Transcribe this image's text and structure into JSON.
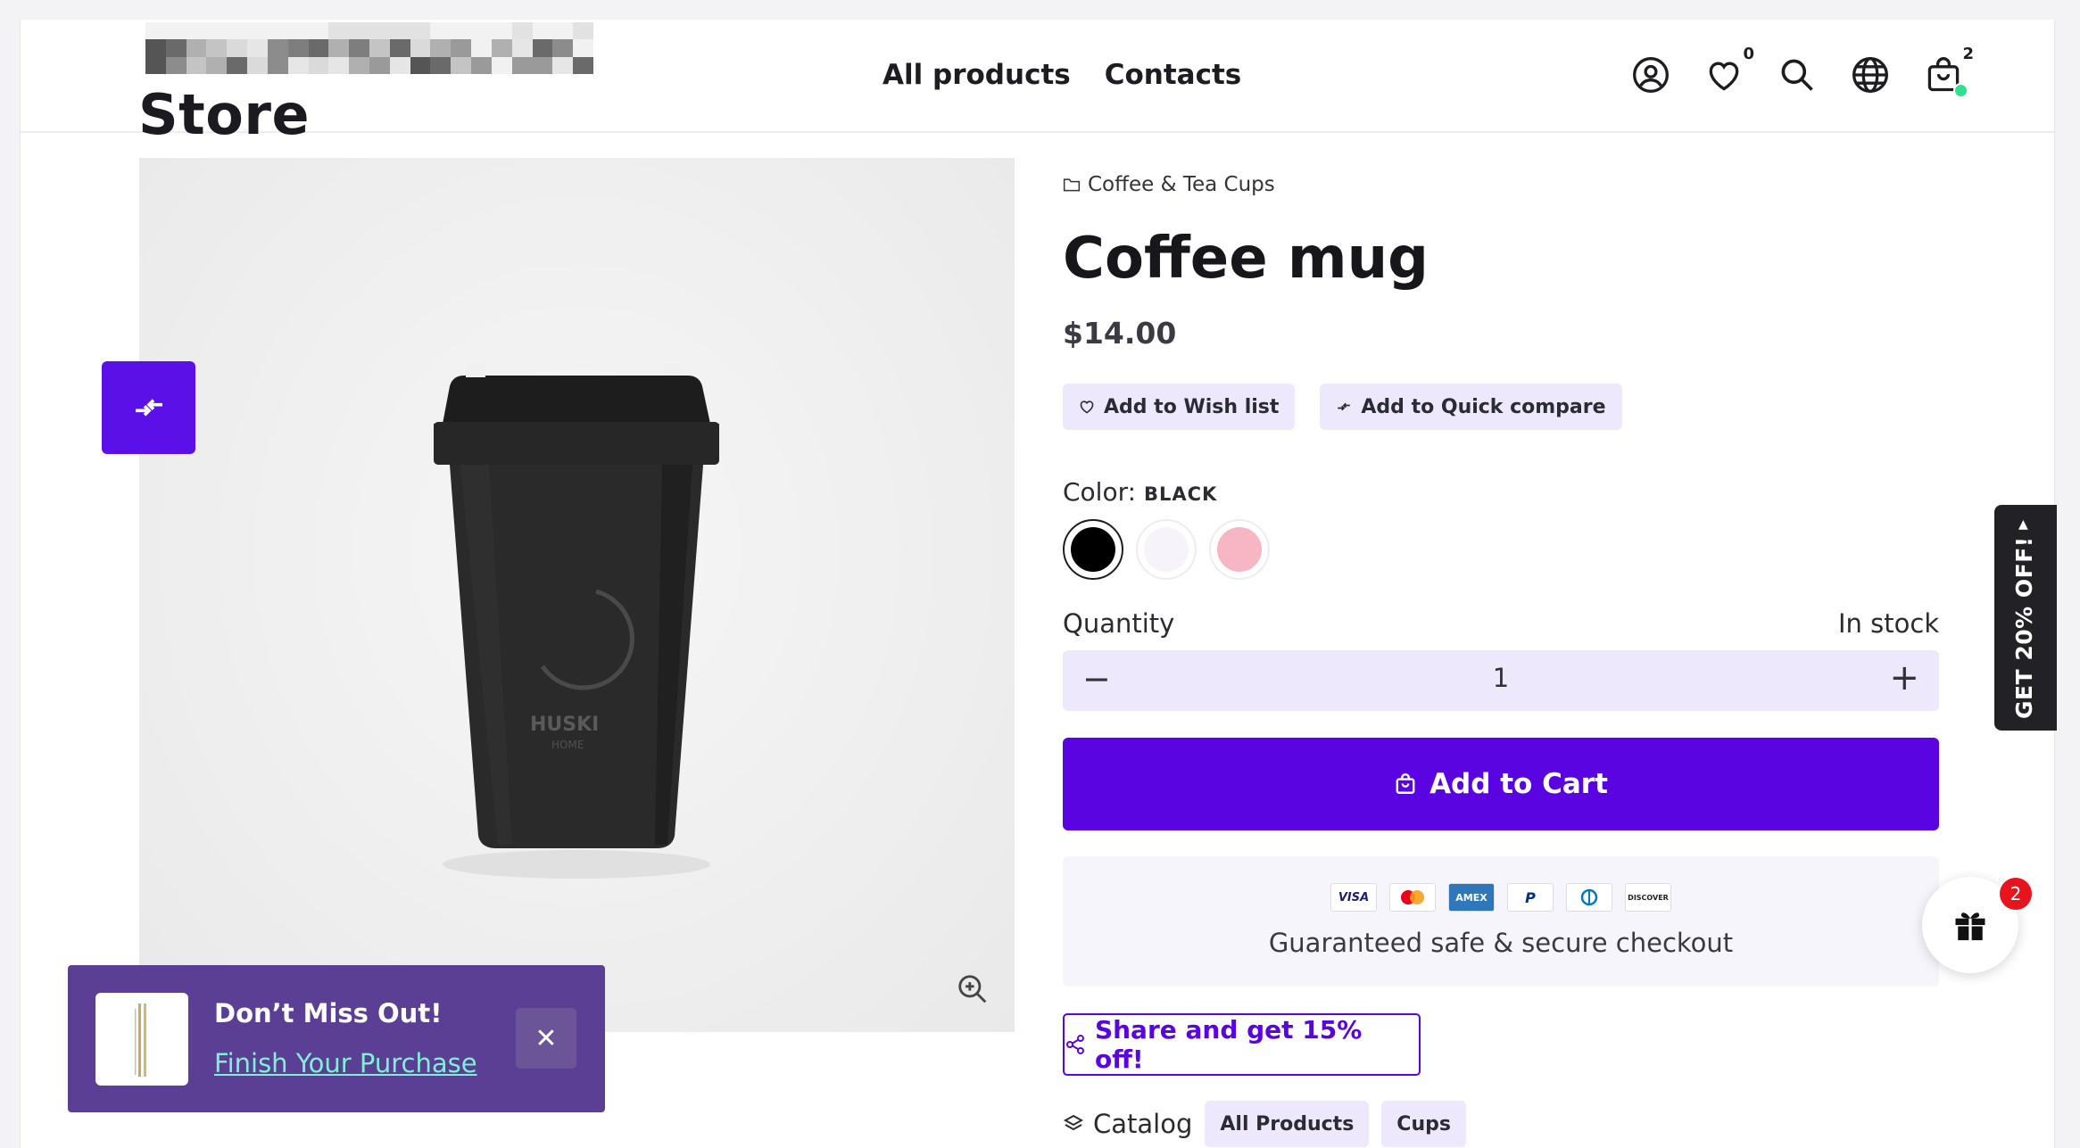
{
  "header": {
    "store_title": "Store",
    "nav": [
      "All products",
      "Contacts"
    ],
    "wishlist_count": "0",
    "cart_count": "2",
    "icons": [
      "account-icon",
      "heart-icon",
      "search-icon",
      "globe-icon",
      "shopping-bag-icon"
    ]
  },
  "product": {
    "category": "Coffee & Tea Cups",
    "title": "Coffee mug",
    "price": "$14.00",
    "wishlist_label": "Add to Wish list",
    "compare_label": "Add to Quick compare",
    "color_label": "Color:",
    "color_value": "BLACK",
    "colors": [
      "#000000",
      "#f6f3fb",
      "#f7b6c4"
    ],
    "quantity_label": "Quantity",
    "stock_label": "In stock",
    "quantity_value": "1",
    "quantity_minus": "−",
    "quantity_plus": "+",
    "add_to_cart_label": "Add to Cart",
    "payment_methods": [
      "VISA",
      "Mastercard",
      "AMEX",
      "PayPal",
      "Diners",
      "DISCOVER"
    ],
    "secure_text": "Guaranteed safe & secure checkout",
    "share_label": "Share and get 15% off!",
    "catalog_label": "Catalog",
    "catalog_tags": [
      "All Products",
      "Cups"
    ]
  },
  "image": {
    "brand_text": "HUSKI",
    "brand_sub": "HOME"
  },
  "side_tab": {
    "label": "GET 20% OFF!",
    "arrow": "▲"
  },
  "gift": {
    "badge": "2"
  },
  "popup": {
    "title": "Don’t Miss Out!",
    "link": "Finish Your Purchase",
    "close": "✕"
  },
  "colors": {
    "accent": "#5a04e2",
    "pill_bg": "#ede8fb",
    "popup_bg": "#5b3f94"
  }
}
